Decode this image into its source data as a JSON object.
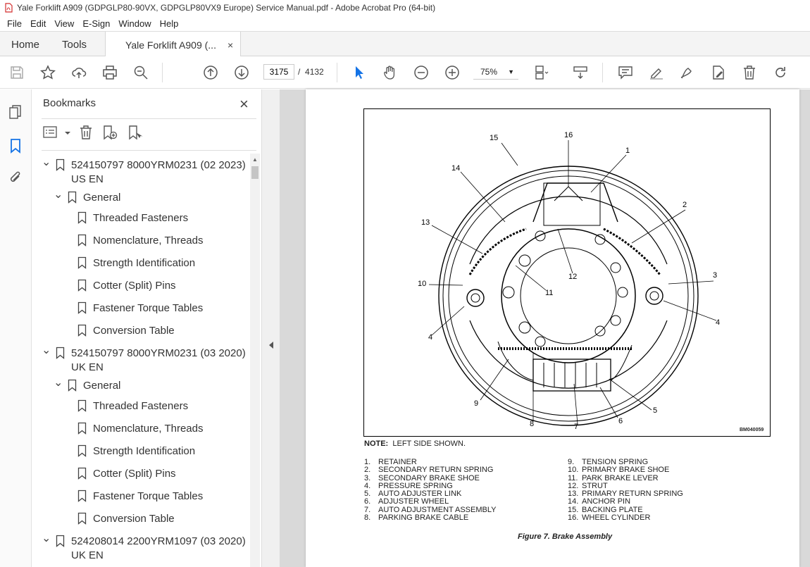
{
  "window": {
    "title": "Yale Forklift A909 (GDPGLP80-90VX, GDPGLP80VX9 Europe) Service Manual.pdf - Adobe Acrobat Pro (64-bit)"
  },
  "menu": [
    "File",
    "Edit",
    "View",
    "E-Sign",
    "Window",
    "Help"
  ],
  "tabs": {
    "home": "Home",
    "tools": "Tools",
    "document": "Yale Forklift A909 (...",
    "close": "×"
  },
  "toolbar": {
    "page_current": "3175",
    "page_separator": "/",
    "page_total": "4132",
    "zoom": "75%"
  },
  "bookmarks": {
    "title": "Bookmarks",
    "close": "×",
    "items": [
      {
        "level": 0,
        "label": "524150797 8000YRM0231 (02 2023)",
        "label2": "US EN",
        "expanded": true
      },
      {
        "level": 1,
        "label": "General",
        "expanded": true
      },
      {
        "level": 2,
        "label": "Threaded Fasteners"
      },
      {
        "level": 2,
        "label": "Nomenclature, Threads"
      },
      {
        "level": 2,
        "label": "Strength Identification"
      },
      {
        "level": 2,
        "label": "Cotter (Split) Pins"
      },
      {
        "level": 2,
        "label": "Fastener Torque Tables"
      },
      {
        "level": 2,
        "label": "Conversion Table"
      },
      {
        "level": 0,
        "label": "524150797 8000YRM0231 (03 2020)",
        "label2": "UK EN",
        "expanded": true
      },
      {
        "level": 1,
        "label": "General",
        "expanded": true
      },
      {
        "level": 2,
        "label": "Threaded Fasteners"
      },
      {
        "level": 2,
        "label": "Nomenclature, Threads"
      },
      {
        "level": 2,
        "label": "Strength Identification"
      },
      {
        "level": 2,
        "label": "Cotter (Split) Pins"
      },
      {
        "level": 2,
        "label": "Fastener Torque Tables"
      },
      {
        "level": 2,
        "label": "Conversion Table"
      },
      {
        "level": 0,
        "label": "524208014 2200YRM1097 (03 2020)",
        "label2": "UK EN",
        "expanded": true
      }
    ]
  },
  "document": {
    "figure_code": "BM040059",
    "callouts": [
      "1",
      "2",
      "3",
      "4",
      "4",
      "5",
      "6",
      "7",
      "8",
      "9",
      "10",
      "11",
      "12",
      "13",
      "14",
      "15",
      "16"
    ],
    "note_label": "NOTE:",
    "note_text": "LEFT SIDE SHOWN.",
    "legend_left": [
      {
        "num": "1.",
        "text": "RETAINER"
      },
      {
        "num": "2.",
        "text": "SECONDARY RETURN SPRING"
      },
      {
        "num": "3.",
        "text": "SECONDARY BRAKE SHOE"
      },
      {
        "num": "4.",
        "text": "PRESSURE SPRING"
      },
      {
        "num": "5.",
        "text": "AUTO ADJUSTER LINK"
      },
      {
        "num": "6.",
        "text": "ADJUSTER WHEEL"
      },
      {
        "num": "7.",
        "text": "AUTO ADJUSTMENT ASSEMBLY"
      },
      {
        "num": "8.",
        "text": "PARKING BRAKE CABLE"
      }
    ],
    "legend_right": [
      {
        "num": "9.",
        "text": "TENSION SPRING"
      },
      {
        "num": "10.",
        "text": "PRIMARY BRAKE SHOE"
      },
      {
        "num": "11.",
        "text": "PARK BRAKE LEVER"
      },
      {
        "num": "12.",
        "text": "STRUT"
      },
      {
        "num": "13.",
        "text": "PRIMARY RETURN SPRING"
      },
      {
        "num": "14.",
        "text": "ANCHOR PIN"
      },
      {
        "num": "15.",
        "text": "BACKING PLATE"
      },
      {
        "num": "16.",
        "text": "WHEEL CYLINDER"
      }
    ],
    "caption": "Figure 7. Brake Assembly"
  }
}
